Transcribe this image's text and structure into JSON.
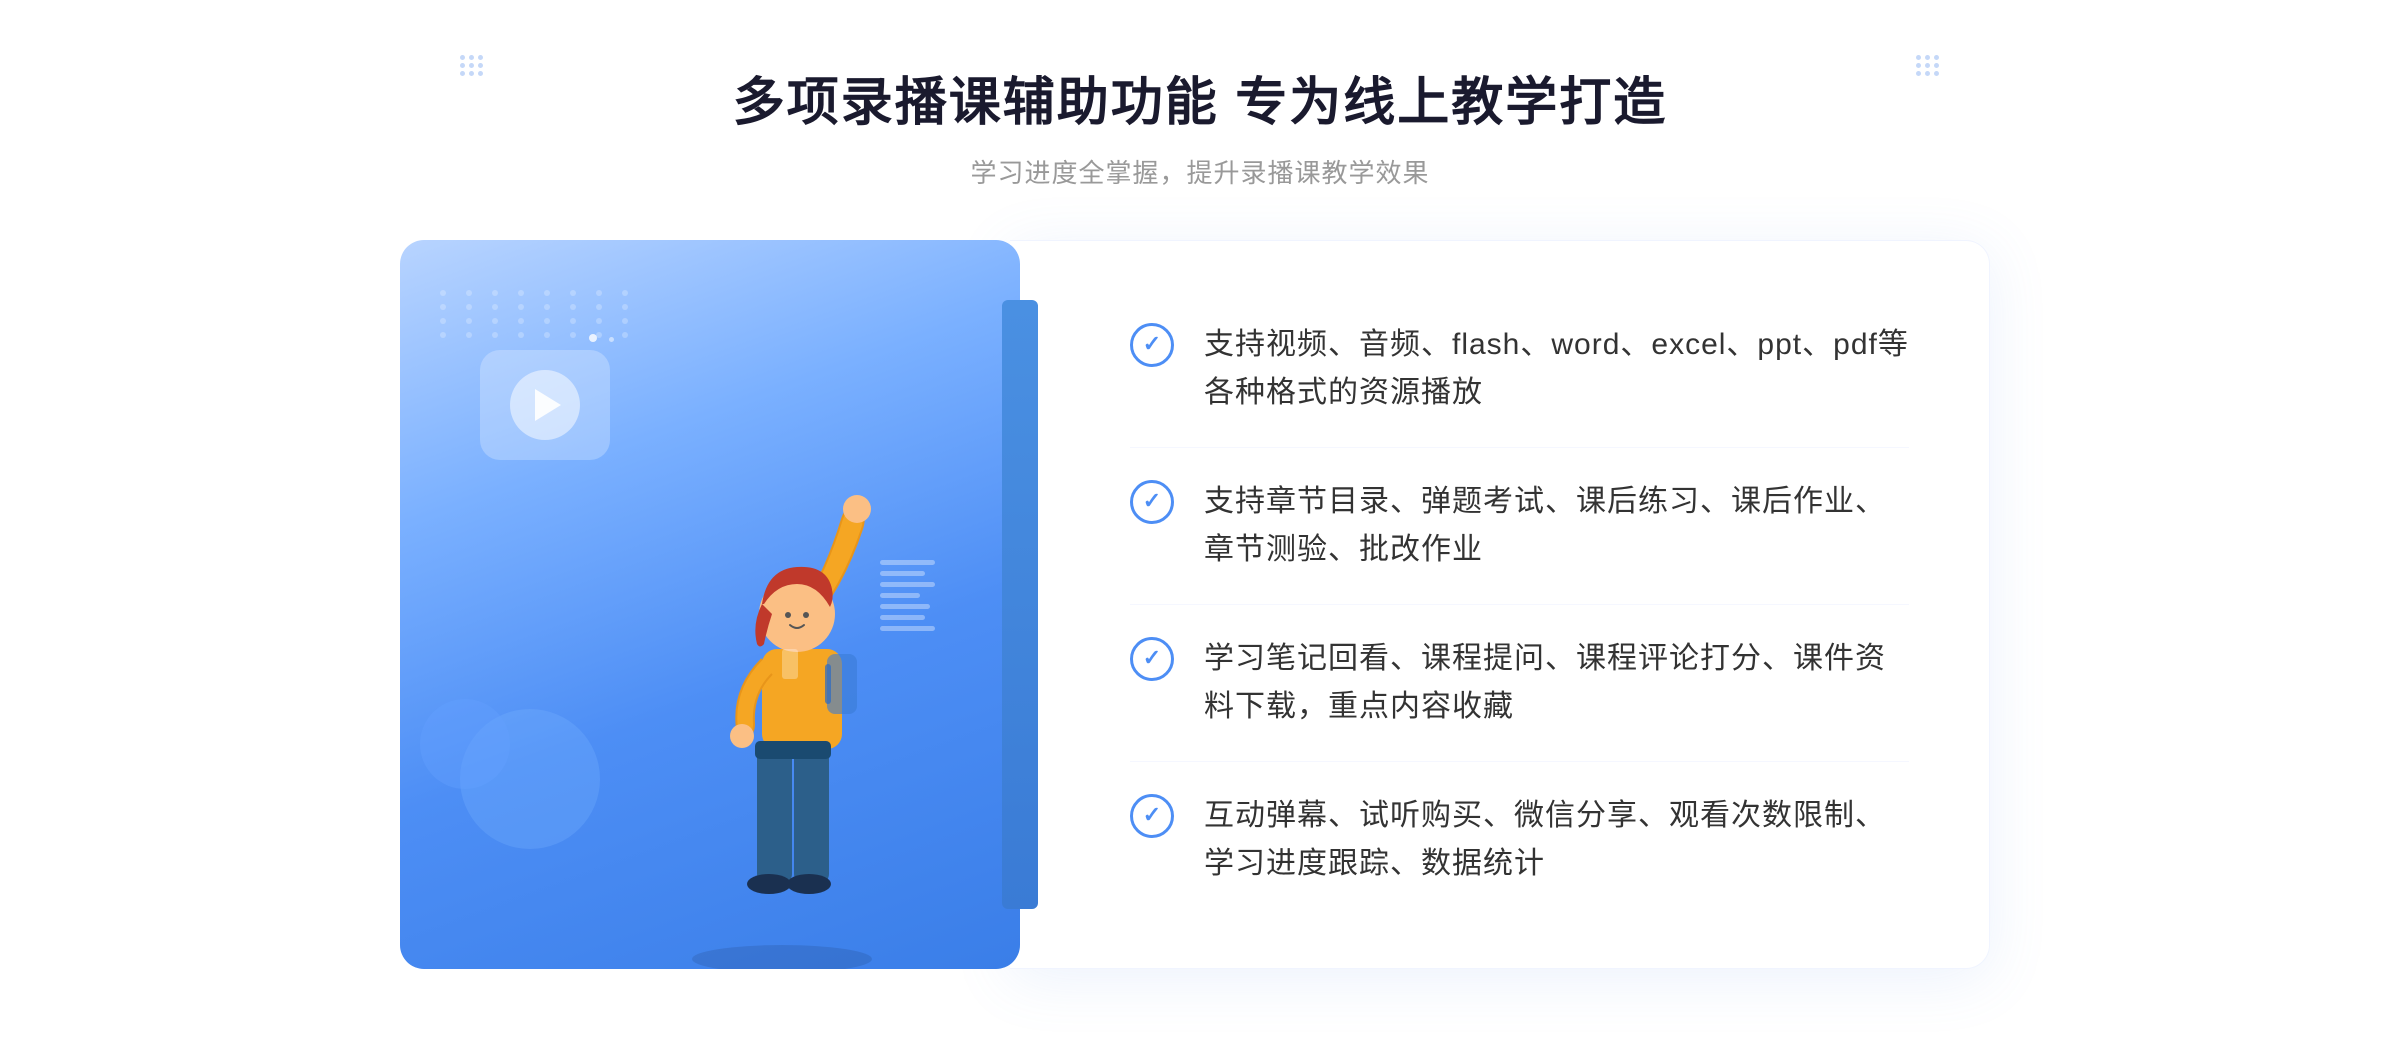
{
  "header": {
    "main_title": "多项录播课辅助功能 专为线上教学打造",
    "sub_title": "学习进度全掌握，提升录播课教学效果"
  },
  "features": [
    {
      "id": "feature-1",
      "text": "支持视频、音频、flash、word、excel、ppt、pdf等各种格式的资源播放"
    },
    {
      "id": "feature-2",
      "text": "支持章节目录、弹题考试、课后练习、课后作业、章节测验、批改作业"
    },
    {
      "id": "feature-3",
      "text": "学习笔记回看、课程提问、课程评论打分、课件资料下载，重点内容收藏"
    },
    {
      "id": "feature-4",
      "text": "互动弹幕、试听购买、微信分享、观看次数限制、学习进度跟踪、数据统计"
    }
  ],
  "decorations": {
    "chevrons": "«",
    "accent_color": "#4d8ef5",
    "bg_color": "#f0f6ff"
  }
}
